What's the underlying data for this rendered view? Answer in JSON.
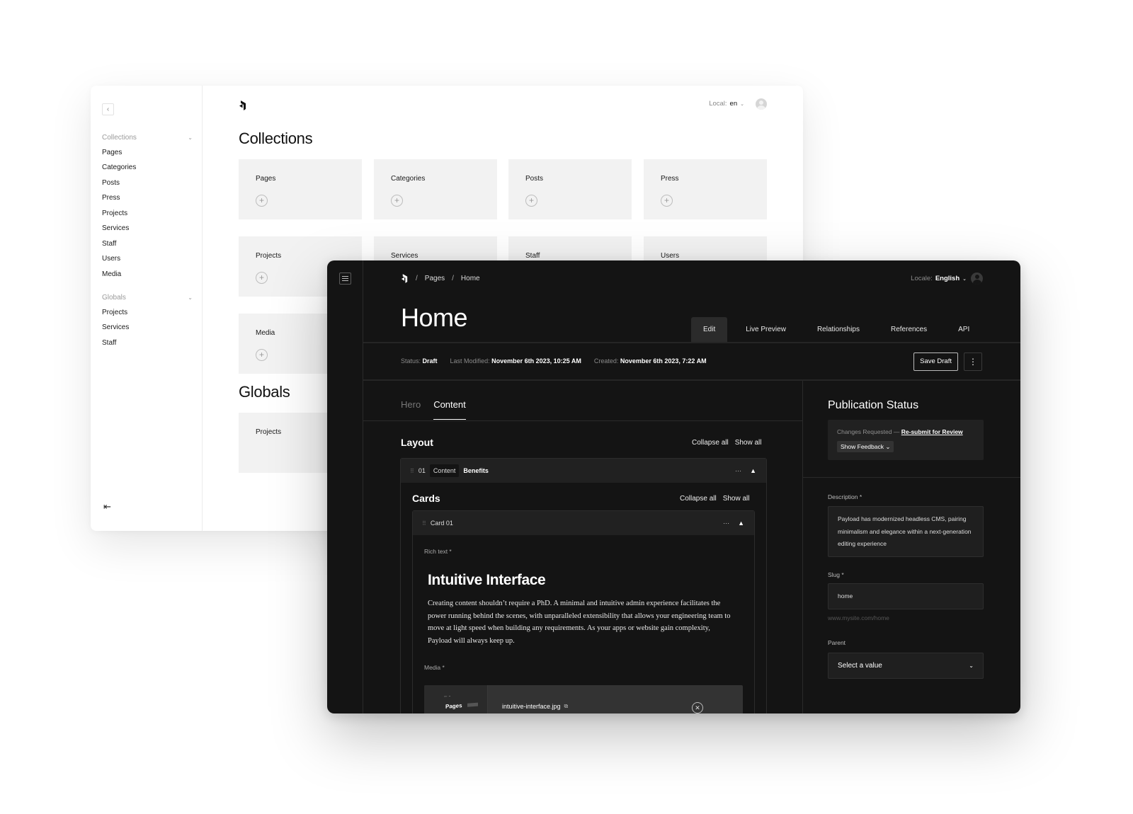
{
  "light_window": {
    "sidebar": {
      "collapse_icon": "chevron-left",
      "groups": [
        {
          "label": "Collections",
          "items": [
            "Pages",
            "Categories",
            "Posts",
            "Press",
            "Projects",
            "Services",
            "Staff",
            "Users",
            "Media"
          ]
        },
        {
          "label": "Globals",
          "items": [
            "Projects",
            "Services",
            "Staff"
          ]
        }
      ],
      "logout_icon": "logout"
    },
    "header": {
      "locale_label": "Local:",
      "locale_value": "en"
    },
    "collections": {
      "title": "Collections",
      "cards": [
        "Pages",
        "Categories",
        "Posts",
        "Press",
        "Projects",
        "Services",
        "Staff",
        "Users",
        "Media"
      ]
    },
    "globals": {
      "title": "Globals",
      "cards": [
        "Projects"
      ]
    }
  },
  "dark_window": {
    "breadcrumb": [
      "Pages",
      "Home"
    ],
    "locale_label": "Locale:",
    "locale_value": "English",
    "title": "Home",
    "tabs": [
      "Edit",
      "Live Preview",
      "Relationships",
      "References",
      "API"
    ],
    "active_tab": "Edit",
    "meta": {
      "status_label": "Status:",
      "status_value": "Draft",
      "modified_label": "Last Modified:",
      "modified_value": "November 6th 2023, 10:25 AM",
      "created_label": "Created:",
      "created_value": "November 6th 2023, 7:22 AM"
    },
    "save_draft": "Save Draft",
    "more_icon": "⋮",
    "subtabs": [
      "Hero",
      "Content"
    ],
    "active_subtab": "Content",
    "layout": {
      "title": "Layout",
      "collapse_all": "Collapse all",
      "show_all": "Show all",
      "block": {
        "index": "01",
        "type": "Content",
        "label": "Benefits",
        "cards": {
          "title": "Cards",
          "collapse_all": "Collapse all",
          "show_all": "Show all",
          "card": {
            "label": "Card 01",
            "rich_text_label": "Rich text *",
            "heading": "Intuitive Interface",
            "paragraph": "Creating content shouldn’t require a PhD. A minimal and intuitive admin experience facilitates the power running behind the scenes, with unparalleled extensibility that allows your engineering team to move at light speed when building any requirements. As your apps or website gain complexity, Payload will always keep up.",
            "media_label": "Media *",
            "media_thumb_title": "Pages",
            "media_filename": "intuitive-interface.jpg"
          }
        }
      }
    },
    "sidebar": {
      "publication_title": "Publication Status",
      "changes_requested": "Changes Requested —",
      "resubmit_link": "Re-submit for Review",
      "show_feedback": "Show Feedback",
      "description_label": "Description *",
      "description_value": "Payload has modernized headless CMS, pairing minimalism and elegance within a next-generation editing experience",
      "slug_label": "Slug *",
      "slug_value": "home",
      "slug_hint": "www.mysite.com/home",
      "parent_label": "Parent",
      "parent_placeholder": "Select a value"
    }
  }
}
